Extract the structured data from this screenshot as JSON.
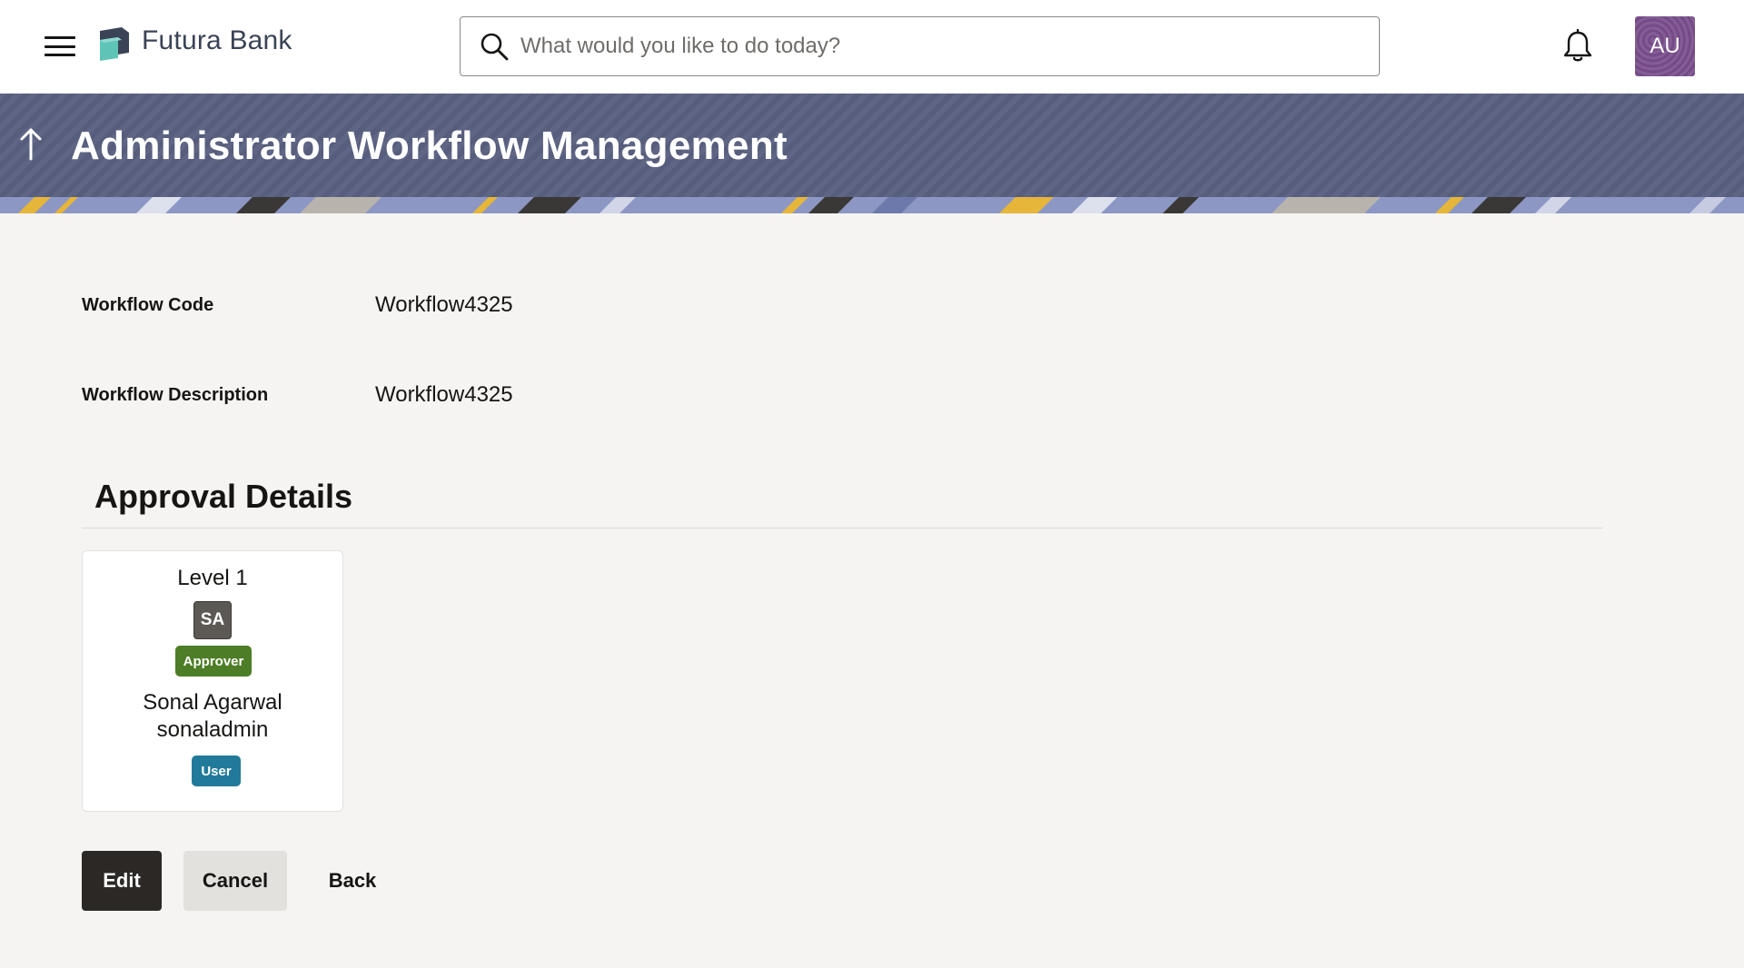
{
  "header": {
    "brand": "Futura Bank",
    "search_placeholder": "What would you like to do today?",
    "avatar_initials": "AU",
    "brand_color": "#3b4356",
    "avatar_color": "#7a4f8d"
  },
  "page": {
    "title": "Administrator Workflow Management",
    "banner_color": "#5a6080"
  },
  "fields": [
    {
      "label": "Workflow Code",
      "value": "Workflow4325"
    },
    {
      "label": "Workflow Description",
      "value": "Workflow4325"
    }
  ],
  "approval": {
    "section_title": "Approval Details",
    "levels": [
      {
        "level": "Level 1",
        "initials": "SA",
        "role_badge": "Approver",
        "name": "Sonal Agarwal",
        "username": "sonaladmin",
        "type_badge": "User"
      }
    ]
  },
  "actions": {
    "edit": "Edit",
    "cancel": "Cancel",
    "back": "Back"
  },
  "icons": [
    "hamburger-menu-icon",
    "futura-bank-logo-icon",
    "search-icon",
    "notification-bell-icon",
    "back-arrow-icon"
  ]
}
